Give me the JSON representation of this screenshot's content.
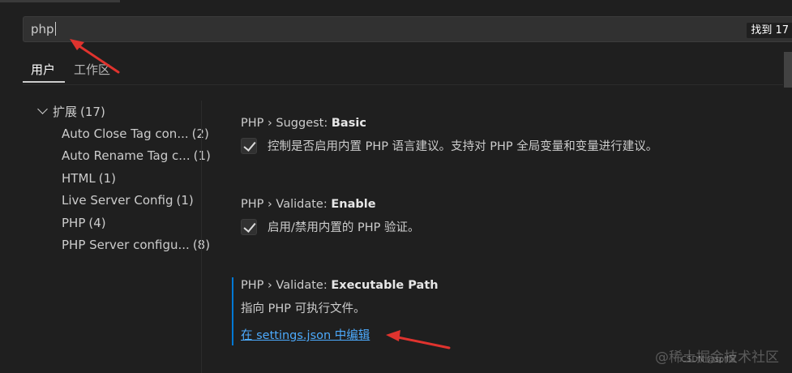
{
  "search": {
    "value": "php",
    "result_badge": "找到 17"
  },
  "tabs": [
    {
      "label": "用户",
      "active": true
    },
    {
      "label": "工作区",
      "active": false
    }
  ],
  "tree": {
    "group_label": "扩展",
    "group_count": "(17)",
    "items": [
      {
        "label": "Auto Close Tag con...",
        "count": "(2)"
      },
      {
        "label": "Auto Rename Tag c...",
        "count": "(1)"
      },
      {
        "label": "HTML",
        "count": "(1)"
      },
      {
        "label": "Live Server Config",
        "count": "(1)"
      },
      {
        "label": "PHP",
        "count": "(4)"
      },
      {
        "label": "PHP Server configu...",
        "count": "(8)"
      }
    ]
  },
  "settings": [
    {
      "category": "PHP › Suggest: ",
      "name": "Basic",
      "checked": true,
      "description": "控制是否启用内置 PHP 语言建议。支持对 PHP 全局变量和变量进行建议。"
    },
    {
      "category": "PHP › Validate: ",
      "name": "Enable",
      "checked": true,
      "description": "启用/禁用内置的 PHP 验证。"
    },
    {
      "category": "PHP › Validate: ",
      "name": "Executable Path",
      "description": "指向 PHP 可执行文件。",
      "link": "在 settings.json 中编辑"
    }
  ],
  "watermark": {
    "text": "@稀土掘金技术社区",
    "sub": "CSDN @spll区"
  },
  "colors": {
    "background": "#1f1f1f",
    "link": "#4daafc",
    "focus_bar": "#0078d4",
    "annotation_arrow": "#e0332e"
  }
}
